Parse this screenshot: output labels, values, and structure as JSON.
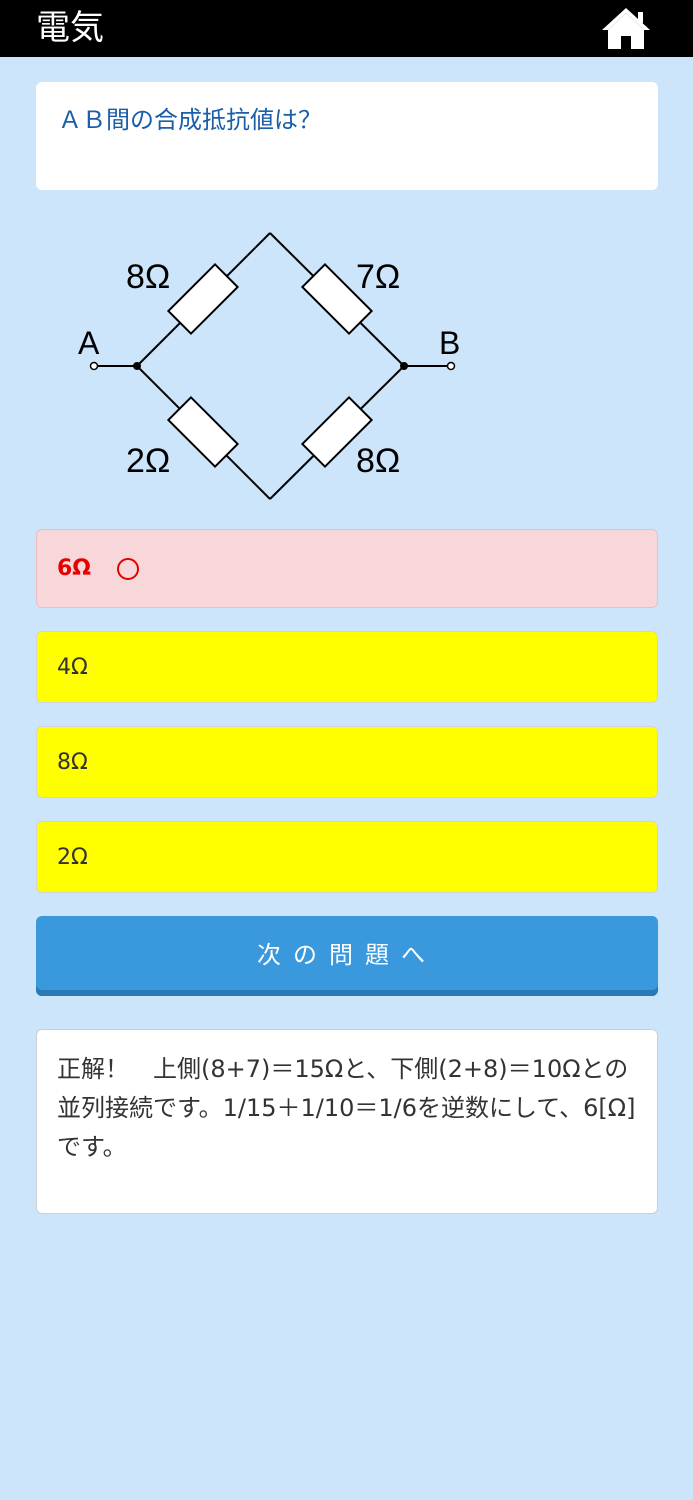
{
  "header": {
    "title": "電気",
    "home_icon": "home-icon"
  },
  "question": {
    "text": "ＡＢ間の合成抵抗値は？"
  },
  "diagram": {
    "terminal_a": "A",
    "terminal_b": "B",
    "r_top_left": "8Ω",
    "r_top_right": "7Ω",
    "r_bottom_left": "2Ω",
    "r_bottom_right": "8Ω"
  },
  "options": [
    {
      "label": "6Ω",
      "state": "correct",
      "mark": "◯"
    },
    {
      "label": "4Ω",
      "state": "default"
    },
    {
      "label": "8Ω",
      "state": "default"
    },
    {
      "label": "2Ω",
      "state": "default"
    }
  ],
  "next_button": {
    "label": "次の問題へ"
  },
  "explanation": {
    "text": "正解！　上側(8+7)＝15Ωと、下側(2+8)＝10Ωとの並列接続です。1/15＋1/10＝1/6を逆数にして、6[Ω]です。"
  },
  "colors": {
    "background": "#cce5fb",
    "header": "#000000",
    "question_text": "#1a5fa8",
    "correct_bg": "#f8d7da",
    "correct_text": "#e60000",
    "option_bg": "#ffff00",
    "button": "#3a98dc"
  }
}
